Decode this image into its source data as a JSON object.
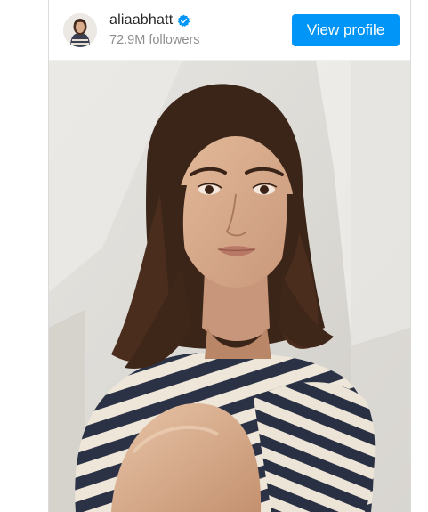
{
  "profile": {
    "username": "aliaabhatt",
    "followers": "72.9M followers",
    "verified_icon": "verified-badge-icon",
    "avatar_icon": "avatar"
  },
  "actions": {
    "view_profile_label": "View profile"
  },
  "colors": {
    "accent": "#0095f6",
    "username": "#262626",
    "secondary_text": "#8e8e8e"
  }
}
